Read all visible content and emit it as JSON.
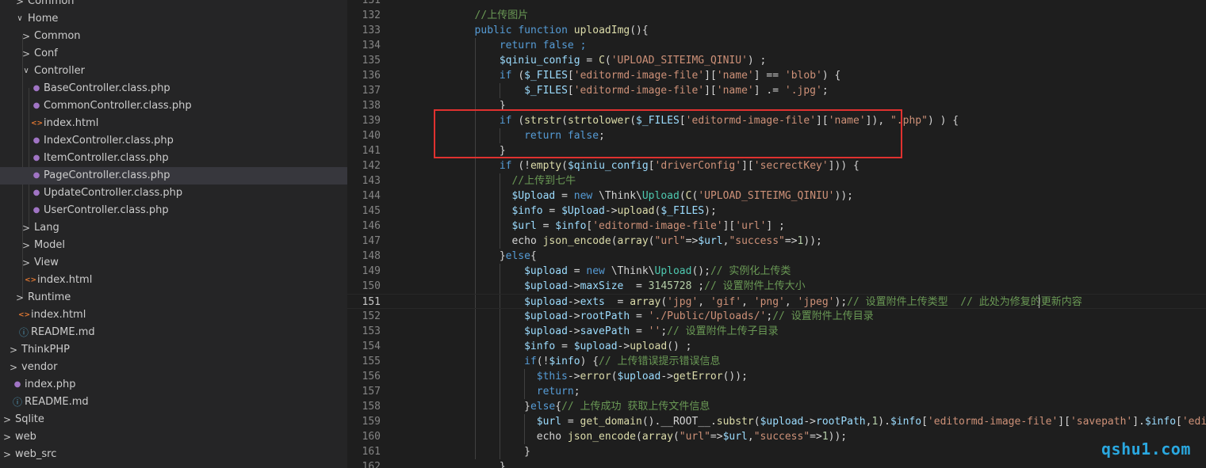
{
  "colors": {
    "sidebar_bg": "#252526",
    "editor_bg": "#1e1e1e",
    "selected_row": "#37373d",
    "highlight_border": "#e0312f",
    "php_icon": "#a074c4",
    "html_icon": "#e37933",
    "info_icon": "#519aba",
    "watermark": "#2aa8e0"
  },
  "explorer": {
    "items": [
      {
        "label": "Common",
        "depth": 2,
        "type": "folder",
        "expanded": false
      },
      {
        "label": "Home",
        "depth": 2,
        "type": "folder",
        "expanded": true
      },
      {
        "label": "Common",
        "depth": 3,
        "type": "folder",
        "expanded": false
      },
      {
        "label": "Conf",
        "depth": 3,
        "type": "folder",
        "expanded": false
      },
      {
        "label": "Controller",
        "depth": 3,
        "type": "folder",
        "expanded": true
      },
      {
        "label": "BaseController.class.php",
        "depth": 4,
        "type": "php"
      },
      {
        "label": "CommonController.class.php",
        "depth": 4,
        "type": "php"
      },
      {
        "label": "index.html",
        "depth": 4,
        "type": "html"
      },
      {
        "label": "IndexController.class.php",
        "depth": 4,
        "type": "php"
      },
      {
        "label": "ItemController.class.php",
        "depth": 4,
        "type": "php"
      },
      {
        "label": "PageController.class.php",
        "depth": 4,
        "type": "php",
        "selected": true
      },
      {
        "label": "UpdateController.class.php",
        "depth": 4,
        "type": "php"
      },
      {
        "label": "UserController.class.php",
        "depth": 4,
        "type": "php"
      },
      {
        "label": "Lang",
        "depth": 3,
        "type": "folder",
        "expanded": false
      },
      {
        "label": "Model",
        "depth": 3,
        "type": "folder",
        "expanded": false
      },
      {
        "label": "View",
        "depth": 3,
        "type": "folder",
        "expanded": false
      },
      {
        "label": "index.html",
        "depth": 3,
        "type": "html"
      },
      {
        "label": "Runtime",
        "depth": 2,
        "type": "folder",
        "expanded": false
      },
      {
        "label": "index.html",
        "depth": 2,
        "type": "html"
      },
      {
        "label": "README.md",
        "depth": 2,
        "type": "info"
      },
      {
        "label": "ThinkPHP",
        "depth": 1,
        "type": "folder",
        "expanded": false
      },
      {
        "label": "vendor",
        "depth": 1,
        "type": "folder",
        "expanded": false
      },
      {
        "label": "index.php",
        "depth": 1,
        "type": "php"
      },
      {
        "label": "README.md",
        "depth": 1,
        "type": "info"
      },
      {
        "label": "Sqlite",
        "depth": 0,
        "type": "folder",
        "expanded": false
      },
      {
        "label": "web",
        "depth": 0,
        "type": "folder",
        "expanded": false
      },
      {
        "label": "web_src",
        "depth": 0,
        "type": "folder",
        "expanded": false
      }
    ]
  },
  "editor": {
    "active_line": "151",
    "lines": [
      {
        "n": "131",
        "indent": 0,
        "tokens": []
      },
      {
        "n": "132",
        "indent": 8,
        "tokens": [
          [
            "//上传图片",
            "comment"
          ]
        ]
      },
      {
        "n": "133",
        "indent": 8,
        "tokens": [
          [
            "public function ",
            "kw"
          ],
          [
            "uploadImg",
            "fn"
          ],
          [
            "(){",
            "plain"
          ]
        ]
      },
      {
        "n": "134",
        "indent": 12,
        "tokens": [
          [
            "return false ;",
            "kw"
          ]
        ]
      },
      {
        "n": "135",
        "indent": 12,
        "tokens": [
          [
            "$qiniu_config",
            "var"
          ],
          [
            " = ",
            "plain"
          ],
          [
            "C",
            "fn"
          ],
          [
            "(",
            "plain"
          ],
          [
            "'UPLOAD_SITEIMG_QINIU'",
            "str"
          ],
          [
            ") ;",
            "plain"
          ]
        ]
      },
      {
        "n": "136",
        "indent": 12,
        "tokens": [
          [
            "if ",
            "kw"
          ],
          [
            "(",
            "plain"
          ],
          [
            "$_FILES",
            "var"
          ],
          [
            "[",
            "plain"
          ],
          [
            "'editormd-image-file'",
            "str"
          ],
          [
            "][",
            "plain"
          ],
          [
            "'name'",
            "str"
          ],
          [
            "] == ",
            "plain"
          ],
          [
            "'blob'",
            "str"
          ],
          [
            ") {",
            "plain"
          ]
        ]
      },
      {
        "n": "137",
        "indent": 16,
        "tokens": [
          [
            "$_FILES",
            "var"
          ],
          [
            "[",
            "plain"
          ],
          [
            "'editormd-image-file'",
            "str"
          ],
          [
            "][",
            "plain"
          ],
          [
            "'name'",
            "str"
          ],
          [
            "] .= ",
            "plain"
          ],
          [
            "'.jpg'",
            "str"
          ],
          [
            ";",
            "plain"
          ]
        ]
      },
      {
        "n": "138",
        "indent": 12,
        "tokens": [
          [
            "}",
            "plain"
          ]
        ]
      },
      {
        "n": "139",
        "indent": 12,
        "tokens": [
          [
            "if ",
            "kw"
          ],
          [
            "(",
            "plain"
          ],
          [
            "strstr",
            "fn"
          ],
          [
            "(",
            "plain"
          ],
          [
            "strtolower",
            "fn"
          ],
          [
            "(",
            "plain"
          ],
          [
            "$_FILES",
            "var"
          ],
          [
            "[",
            "plain"
          ],
          [
            "'editormd-image-file'",
            "str"
          ],
          [
            "][",
            "plain"
          ],
          [
            "'name'",
            "str"
          ],
          [
            "]), ",
            "plain"
          ],
          [
            "\".php\"",
            "str"
          ],
          [
            ") ) {",
            "plain"
          ]
        ]
      },
      {
        "n": "140",
        "indent": 16,
        "tokens": [
          [
            "return false",
            "kw"
          ],
          [
            ";",
            "plain"
          ]
        ]
      },
      {
        "n": "141",
        "indent": 12,
        "tokens": [
          [
            "}",
            "plain"
          ]
        ]
      },
      {
        "n": "142",
        "indent": 12,
        "tokens": [
          [
            "if ",
            "kw"
          ],
          [
            "(!",
            "plain"
          ],
          [
            "empty",
            "fn"
          ],
          [
            "(",
            "plain"
          ],
          [
            "$qiniu_config",
            "var"
          ],
          [
            "[",
            "plain"
          ],
          [
            "'driverConfig'",
            "str"
          ],
          [
            "][",
            "plain"
          ],
          [
            "'secrectKey'",
            "str"
          ],
          [
            "])) {",
            "plain"
          ]
        ]
      },
      {
        "n": "143",
        "indent": 14,
        "tokens": [
          [
            "//上传到七牛",
            "comment"
          ]
        ]
      },
      {
        "n": "144",
        "indent": 14,
        "tokens": [
          [
            "$Upload",
            "var"
          ],
          [
            " = ",
            "plain"
          ],
          [
            "new ",
            "kw"
          ],
          [
            "\\Think\\",
            "plain"
          ],
          [
            "Upload",
            "cls"
          ],
          [
            "(",
            "plain"
          ],
          [
            "C",
            "fn"
          ],
          [
            "(",
            "plain"
          ],
          [
            "'UPLOAD_SITEIMG_QINIU'",
            "str"
          ],
          [
            "));",
            "plain"
          ]
        ]
      },
      {
        "n": "145",
        "indent": 14,
        "tokens": [
          [
            "$info",
            "var"
          ],
          [
            " = ",
            "plain"
          ],
          [
            "$Upload",
            "var"
          ],
          [
            "->",
            "plain"
          ],
          [
            "upload",
            "fn"
          ],
          [
            "(",
            "plain"
          ],
          [
            "$_FILES",
            "var"
          ],
          [
            ");",
            "plain"
          ]
        ]
      },
      {
        "n": "146",
        "indent": 14,
        "tokens": [
          [
            "$url",
            "var"
          ],
          [
            " = ",
            "plain"
          ],
          [
            "$info",
            "var"
          ],
          [
            "[",
            "plain"
          ],
          [
            "'editormd-image-file'",
            "str"
          ],
          [
            "][",
            "plain"
          ],
          [
            "'url'",
            "str"
          ],
          [
            "] ;",
            "plain"
          ]
        ]
      },
      {
        "n": "147",
        "indent": 14,
        "tokens": [
          [
            "echo ",
            "plain"
          ],
          [
            "json_encode",
            "fn"
          ],
          [
            "(",
            "plain"
          ],
          [
            "array",
            "fn"
          ],
          [
            "(",
            "plain"
          ],
          [
            "\"url\"",
            "str"
          ],
          [
            "=>",
            "plain"
          ],
          [
            "$url",
            "var"
          ],
          [
            ",",
            "plain"
          ],
          [
            "\"success\"",
            "str"
          ],
          [
            "=>",
            "plain"
          ],
          [
            "1",
            "num"
          ],
          [
            "));",
            "plain"
          ]
        ]
      },
      {
        "n": "148",
        "indent": 12,
        "tokens": [
          [
            "}",
            "plain"
          ],
          [
            "else",
            "kw"
          ],
          [
            "{",
            "plain"
          ]
        ]
      },
      {
        "n": "149",
        "indent": 16,
        "tokens": [
          [
            "$upload",
            "var"
          ],
          [
            " = ",
            "plain"
          ],
          [
            "new ",
            "kw"
          ],
          [
            "\\Think\\",
            "plain"
          ],
          [
            "Upload",
            "cls"
          ],
          [
            "();",
            "plain"
          ],
          [
            "// 实例化上传类",
            "comment"
          ]
        ]
      },
      {
        "n": "150",
        "indent": 16,
        "tokens": [
          [
            "$upload",
            "var"
          ],
          [
            "->",
            "plain"
          ],
          [
            "maxSize",
            "var"
          ],
          [
            "  = ",
            "plain"
          ],
          [
            "3145728",
            "num"
          ],
          [
            " ;",
            "plain"
          ],
          [
            "// 设置附件上传大小",
            "comment"
          ]
        ]
      },
      {
        "n": "151",
        "indent": 16,
        "tokens": [
          [
            "$upload",
            "var"
          ],
          [
            "->",
            "plain"
          ],
          [
            "exts",
            "var"
          ],
          [
            "  = ",
            "plain"
          ],
          [
            "array",
            "fn"
          ],
          [
            "(",
            "plain"
          ],
          [
            "'jpg'",
            "str"
          ],
          [
            ", ",
            "plain"
          ],
          [
            "'gif'",
            "str"
          ],
          [
            ", ",
            "plain"
          ],
          [
            "'png'",
            "str"
          ],
          [
            ", ",
            "plain"
          ],
          [
            "'jpeg'",
            "str"
          ],
          [
            ");",
            "plain"
          ],
          [
            "// 设置附件上传类型  // 此处为修复的更新内容",
            "comment"
          ]
        ]
      },
      {
        "n": "152",
        "indent": 16,
        "tokens": [
          [
            "$upload",
            "var"
          ],
          [
            "->",
            "plain"
          ],
          [
            "rootPath",
            "var"
          ],
          [
            " = ",
            "plain"
          ],
          [
            "'./Public/Uploads/'",
            "str"
          ],
          [
            ";",
            "plain"
          ],
          [
            "// 设置附件上传目录",
            "comment"
          ]
        ]
      },
      {
        "n": "153",
        "indent": 16,
        "tokens": [
          [
            "$upload",
            "var"
          ],
          [
            "->",
            "plain"
          ],
          [
            "savePath",
            "var"
          ],
          [
            " = ",
            "plain"
          ],
          [
            "''",
            "str"
          ],
          [
            ";",
            "plain"
          ],
          [
            "// 设置附件上传子目录",
            "comment"
          ]
        ]
      },
      {
        "n": "154",
        "indent": 16,
        "tokens": [
          [
            "$info",
            "var"
          ],
          [
            " = ",
            "plain"
          ],
          [
            "$upload",
            "var"
          ],
          [
            "->",
            "plain"
          ],
          [
            "upload",
            "fn"
          ],
          [
            "() ;",
            "plain"
          ]
        ]
      },
      {
        "n": "155",
        "indent": 16,
        "tokens": [
          [
            "if",
            "kw"
          ],
          [
            "(!",
            "plain"
          ],
          [
            "$info",
            "var"
          ],
          [
            ") {",
            "plain"
          ],
          [
            "// 上传错误提示错误信息",
            "comment"
          ]
        ]
      },
      {
        "n": "156",
        "indent": 18,
        "tokens": [
          [
            "$this",
            "kw"
          ],
          [
            "->",
            "plain"
          ],
          [
            "error",
            "fn"
          ],
          [
            "(",
            "plain"
          ],
          [
            "$upload",
            "var"
          ],
          [
            "->",
            "plain"
          ],
          [
            "getError",
            "fn"
          ],
          [
            "());",
            "plain"
          ]
        ]
      },
      {
        "n": "157",
        "indent": 18,
        "tokens": [
          [
            "return",
            "kw"
          ],
          [
            ";",
            "plain"
          ]
        ]
      },
      {
        "n": "158",
        "indent": 16,
        "tokens": [
          [
            "}",
            "plain"
          ],
          [
            "else",
            "kw"
          ],
          [
            "{",
            "plain"
          ],
          [
            "// 上传成功 获取上传文件信息",
            "comment"
          ]
        ]
      },
      {
        "n": "159",
        "indent": 18,
        "tokens": [
          [
            "$url",
            "var"
          ],
          [
            " = ",
            "plain"
          ],
          [
            "get_domain",
            "fn"
          ],
          [
            "().",
            "plain"
          ],
          [
            "__ROOT__",
            "plain"
          ],
          [
            ".",
            "plain"
          ],
          [
            "substr",
            "fn"
          ],
          [
            "(",
            "plain"
          ],
          [
            "$upload",
            "var"
          ],
          [
            "->",
            "plain"
          ],
          [
            "rootPath",
            "var"
          ],
          [
            ",",
            "plain"
          ],
          [
            "1",
            "num"
          ],
          [
            ").",
            "plain"
          ],
          [
            "$info",
            "var"
          ],
          [
            "[",
            "plain"
          ],
          [
            "'editormd-image-file'",
            "str"
          ],
          [
            "][",
            "plain"
          ],
          [
            "'savepath'",
            "str"
          ],
          [
            "].",
            "plain"
          ],
          [
            "$info",
            "var"
          ],
          [
            "[",
            "plain"
          ],
          [
            "'editormd-image-file'",
            "str"
          ]
        ]
      },
      {
        "n": "160",
        "indent": 18,
        "tokens": [
          [
            "echo ",
            "plain"
          ],
          [
            "json_encode",
            "fn"
          ],
          [
            "(",
            "plain"
          ],
          [
            "array",
            "fn"
          ],
          [
            "(",
            "plain"
          ],
          [
            "\"url\"",
            "str"
          ],
          [
            "=>",
            "plain"
          ],
          [
            "$url",
            "var"
          ],
          [
            ",",
            "plain"
          ],
          [
            "\"success\"",
            "str"
          ],
          [
            "=>",
            "plain"
          ],
          [
            "1",
            "num"
          ],
          [
            "));",
            "plain"
          ]
        ]
      },
      {
        "n": "161",
        "indent": 16,
        "tokens": [
          [
            "}",
            "plain"
          ]
        ]
      },
      {
        "n": "162",
        "indent": 12,
        "tokens": [
          [
            "}",
            "plain"
          ]
        ]
      }
    ]
  },
  "watermark": "qshu1.com"
}
